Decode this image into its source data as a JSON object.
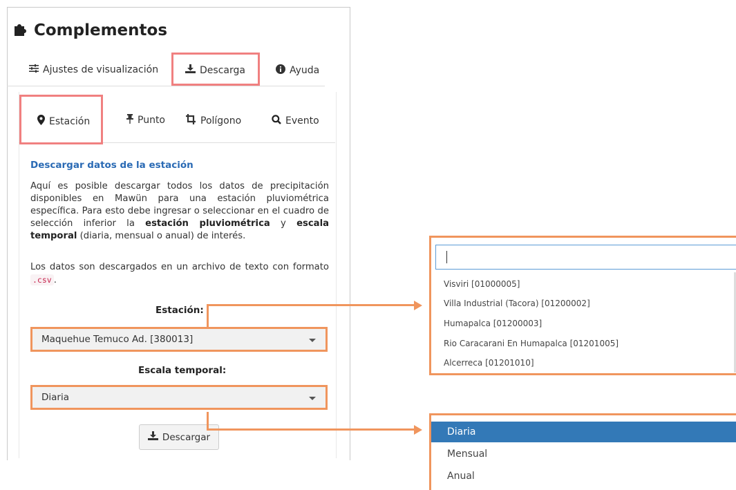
{
  "title": "Complementos",
  "main_tabs": [
    {
      "label": "Ajustes de visualización",
      "icon": "sliders-icon"
    },
    {
      "label": "Descarga",
      "icon": "download-icon"
    },
    {
      "label": "Ayuda",
      "icon": "info-circle-icon"
    }
  ],
  "sub_tabs": [
    {
      "label": "Estación",
      "icon": "map-marker-icon"
    },
    {
      "label": "Punto",
      "icon": "pushpin-icon"
    },
    {
      "label": "Polígono",
      "icon": "crop-icon"
    },
    {
      "label": "Evento",
      "icon": "search-icon"
    }
  ],
  "content": {
    "heading": "Descargar datos de la estación",
    "p1_a": "Aquí es posible descargar todos los datos de precipitación disponibles en Mawün para una estación pluviométrica específica. Para esto debe ingresar o seleccionar en el cuadro de selección inferior la ",
    "p1_b1": "estación pluviométrica",
    "p1_c": " y ",
    "p1_b2": "escala temporal",
    "p1_d": " (diaria, mensual o anual) de interés.",
    "p2_a": "Los datos son descargados en un archivo de texto con formato ",
    "p2_code": ".csv",
    "p2_b": "."
  },
  "station": {
    "label": "Estación:",
    "value": "Maquehue Temuco Ad. [380013]"
  },
  "scale": {
    "label": "Escala temporal:",
    "value": "Diaria"
  },
  "download_button": "Descargar",
  "station_dropdown": {
    "search_value": "",
    "options": [
      "Visviri [01000005]",
      "Villa Industrial (Tacora) [01200002]",
      "Humapalca [01200003]",
      "Rio Caracarani En Humapalca [01201005]",
      "Alcerreca [01201010]"
    ]
  },
  "scale_dropdown": {
    "options": [
      "Diaria",
      "Mensual",
      "Anual"
    ],
    "selected": "Diaria"
  },
  "colors": {
    "highlight_pink": "#f08080",
    "highlight_orange": "#f0955d",
    "accent_blue": "#3379b7",
    "heading_blue": "#2a6ab4"
  }
}
